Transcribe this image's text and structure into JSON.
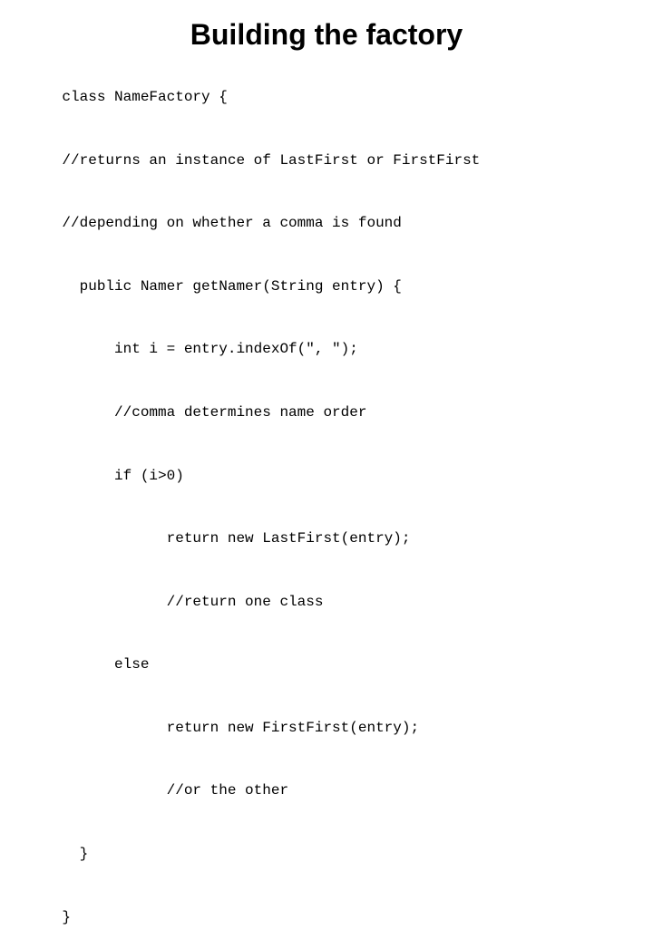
{
  "title": "Building the factory",
  "code": {
    "lines": [
      "class NameFactory {",
      "//returns an instance of LastFirst or FirstFirst",
      "//depending on whether a comma is found",
      "  public Namer getNamer(String entry) {",
      "      int i = entry.indexOf(\", \");",
      "      //comma determines name order",
      "      if (i>0)",
      "            return new LastFirst(entry);",
      "            //return one class",
      "      else",
      "            return new FirstFirst(entry);",
      "            //or the other",
      "  }",
      "}"
    ]
  }
}
